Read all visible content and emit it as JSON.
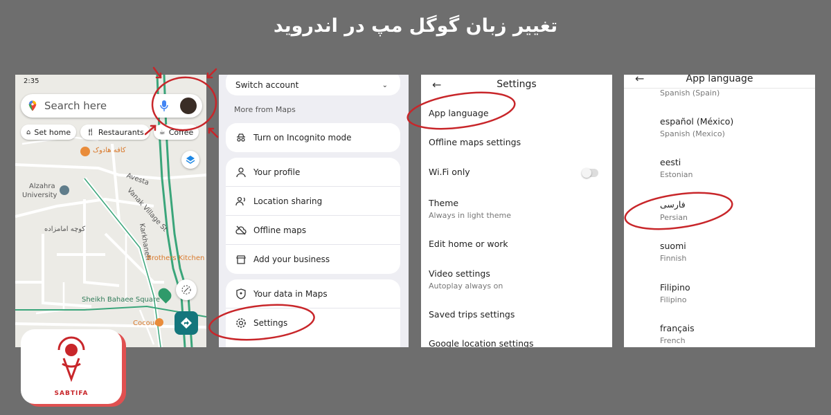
{
  "page_title": "تغییر زبان گوگل مپ در اندروید",
  "colors": {
    "annotation": "#c8262a",
    "route": "#3aa57a",
    "accent": "#1a73e8"
  },
  "map_panel": {
    "status_time": "2:35",
    "search_placeholder": "Search here",
    "chips": [
      {
        "icon": "home-icon",
        "label": "Set home"
      },
      {
        "icon": "fork-knife-icon",
        "label": "Restaurants"
      },
      {
        "icon": "coffee-icon",
        "label": "Coffee"
      }
    ],
    "labels": {
      "cafe": "کافه هادوک",
      "avesta": "Avesta",
      "alzahra": "Alzahra",
      "university": "University",
      "vanak": "Vanak Village St",
      "karkhaneh": "Karkhaneh",
      "kooche": "کوچه امامزاده",
      "brothers": "Brothers Kitchen",
      "sheikh": "Sheikh Bahaee Square",
      "cocouch": "Cocouch"
    }
  },
  "account_panel": {
    "switch_account": "Switch account",
    "more_from_maps": "More from Maps",
    "incognito": "Turn on Incognito mode",
    "items": [
      "Your profile",
      "Location sharing",
      "Offline maps",
      "Add your business"
    ],
    "items2": [
      "Your data in Maps",
      "Settings"
    ]
  },
  "settings_panel": {
    "title": "Settings",
    "app_language": "App language",
    "offline_maps_settings": "Offline maps settings",
    "wifi_only": "Wi.Fi only",
    "theme": "Theme",
    "theme_sub": "Always in light theme",
    "edit_home": "Edit home or work",
    "video_settings": "Video settings",
    "video_sub": "Autoplay always on",
    "saved_trips": "Saved trips settings",
    "google_location": "Google location settings"
  },
  "language_panel": {
    "title": "App language",
    "top_sub": "Spanish (Spain)",
    "languages": [
      {
        "name": "español (México)",
        "sub": "Spanish (Mexico)"
      },
      {
        "name": "eesti",
        "sub": "Estonian"
      },
      {
        "name": "فارسی",
        "sub": "Persian"
      },
      {
        "name": "suomi",
        "sub": "Finnish"
      },
      {
        "name": "Filipino",
        "sub": "Filipino"
      },
      {
        "name": "français",
        "sub": "French"
      }
    ]
  },
  "logo": {
    "brand": "SABTIFA"
  }
}
